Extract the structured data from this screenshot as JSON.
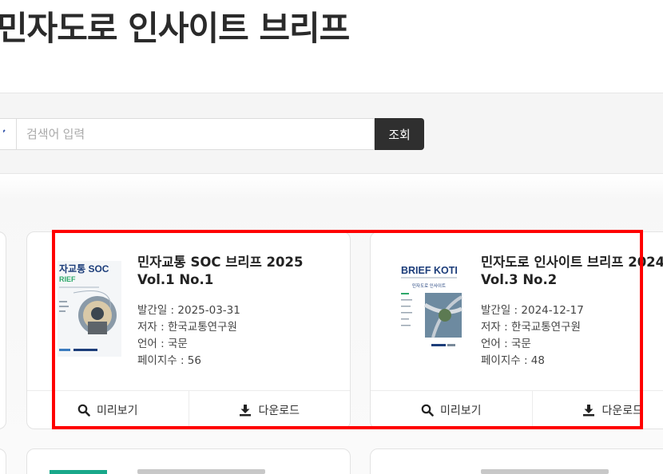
{
  "page": {
    "title": "민자도로 인사이트 브리프"
  },
  "search": {
    "placeholder": "검색어 입력",
    "value": "",
    "button_label": "조회"
  },
  "cards": [
    {
      "title": "민자교통 SOC 브리프 2025 Vol.1 No.1",
      "cover_text": {
        "line1": "자교통 SOC",
        "line2": "RIEF"
      },
      "published": "발간일 : 2025-03-31",
      "author": "저자 : 한국교통연구원",
      "language": "언어 : 국문",
      "pages": "페이지수 : 56",
      "preview_label": "미리보기",
      "download_label": "다운로드"
    },
    {
      "title": "민자도로 인사이트 브리프 2024 Vol.3 No.2",
      "cover_text": {
        "line1": "BRIEF KOTI",
        "line2": "민자도로 인사이트"
      },
      "published": "발간일 : 2024-12-17",
      "author": "저자 : 한국교통연구원",
      "language": "언어 : 국문",
      "pages": "페이지수 : 48",
      "preview_label": "미리보기",
      "download_label": "다운로드"
    }
  ],
  "colors": {
    "highlight": "#ff0000",
    "button_dark": "#2f2f2f",
    "accent_green": "#19a88a"
  },
  "icons": [
    "chevron-down-icon",
    "search-icon",
    "download-icon"
  ]
}
